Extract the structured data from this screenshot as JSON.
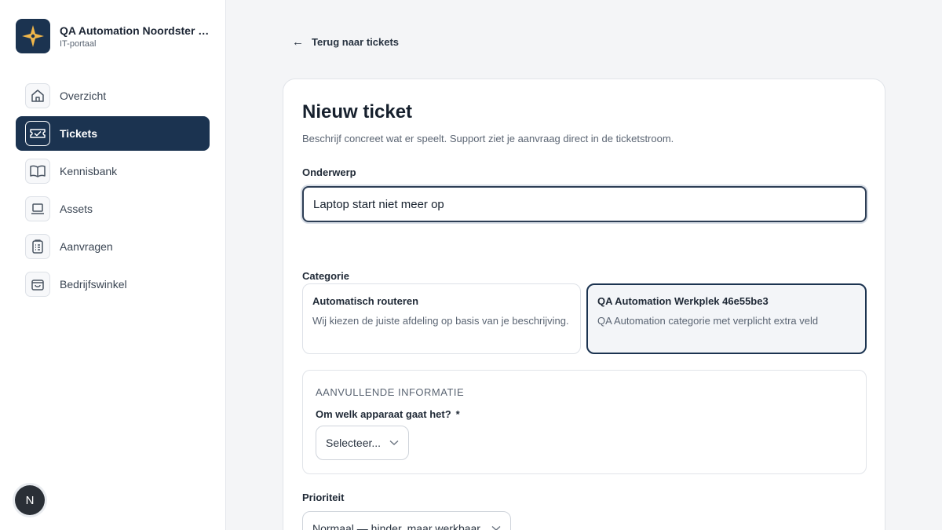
{
  "brand": {
    "title": "QA Automation Noordster T...",
    "subtitle": "IT-portaal",
    "logo_icon": "compass-star-icon",
    "accent": "#1b3350",
    "star_color": "#f0b64a"
  },
  "nav": {
    "items": [
      {
        "label": "Overzicht",
        "icon": "home-icon",
        "active": false
      },
      {
        "label": "Tickets",
        "icon": "ticket-icon",
        "active": true
      },
      {
        "label": "Kennisbank",
        "icon": "book-icon",
        "active": false
      },
      {
        "label": "Assets",
        "icon": "laptop-icon",
        "active": false
      },
      {
        "label": "Aanvragen",
        "icon": "clipboard-icon",
        "active": false
      },
      {
        "label": "Bedrijfswinkel",
        "icon": "shopping-bag-icon",
        "active": false
      }
    ]
  },
  "user": {
    "avatar_initial": "N"
  },
  "back_link": {
    "label": "Terug naar tickets"
  },
  "form": {
    "title": "Nieuw ticket",
    "description": "Beschrijf concreet wat er speelt. Support ziet je aanvraag direct in de ticketstroom.",
    "subject": {
      "label": "Onderwerp",
      "value": "Laptop start niet meer op"
    },
    "category": {
      "label": "Categorie",
      "options": [
        {
          "title": "Automatisch routeren",
          "description": "Wij kiezen de juiste afdeling op basis van je beschrijving.",
          "selected": false
        },
        {
          "title": "QA Automation Werkplek 46e55be3",
          "description": "QA Automation categorie met verplicht extra veld",
          "selected": true
        }
      ]
    },
    "extra": {
      "heading": "AANVULLENDE INFORMATIE",
      "question": "Om welk apparaat gaat het?",
      "required_mark": "*",
      "select_value": "Selecteer..."
    },
    "priority": {
      "label": "Prioriteit",
      "value": "Normaal — hinder, maar werkbaar"
    }
  }
}
